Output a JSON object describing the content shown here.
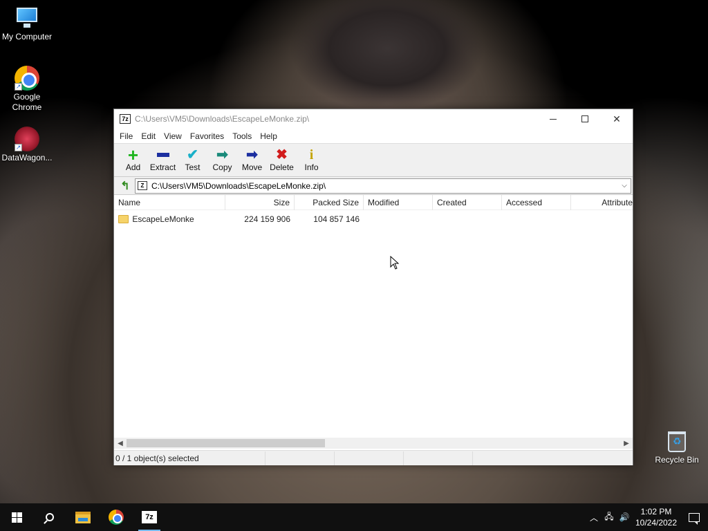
{
  "desktop": {
    "icons": [
      {
        "label_line1": "My Computer",
        "label_line2": ""
      },
      {
        "label_line1": "Google",
        "label_line2": "Chrome"
      },
      {
        "label_line1": "DataWagon...",
        "label_line2": ""
      }
    ],
    "recycle_bin": "Recycle Bin"
  },
  "window": {
    "title": "C:\\Users\\VM5\\Downloads\\EscapeLeMonke.zip\\",
    "app_badge": "7z",
    "menu": [
      "File",
      "Edit",
      "View",
      "Favorites",
      "Tools",
      "Help"
    ],
    "toolbar": [
      {
        "label": "Add",
        "icon": "plus-icon"
      },
      {
        "label": "Extract",
        "icon": "minus-icon"
      },
      {
        "label": "Test",
        "icon": "check-icon"
      },
      {
        "label": "Copy",
        "icon": "copy-arrow-icon"
      },
      {
        "label": "Move",
        "icon": "move-arrow-icon"
      },
      {
        "label": "Delete",
        "icon": "delete-x-icon"
      },
      {
        "label": "Info",
        "icon": "info-icon"
      }
    ],
    "address": "C:\\Users\\VM5\\Downloads\\EscapeLeMonke.zip\\",
    "columns": {
      "name": "Name",
      "size": "Size",
      "packed": "Packed Size",
      "modified": "Modified",
      "created": "Created",
      "accessed": "Accessed",
      "attributes": "Attribute"
    },
    "rows": [
      {
        "name": "EscapeLeMonke",
        "size": "224 159 906",
        "packed": "104 857 146",
        "modified": "",
        "created": "",
        "accessed": "",
        "attributes": ""
      }
    ],
    "status": {
      "selection": "0 / 1 object(s) selected",
      "cell2": "",
      "cell3": "",
      "cell4": ""
    }
  },
  "taskbar": {
    "time": "1:02 PM",
    "date": "10/24/2022",
    "pinned": [
      "start-icon",
      "search-icon",
      "file-explorer-icon",
      "chrome-icon",
      "7zip-icon"
    ]
  },
  "colors": {
    "taskbar_bg": "#101010",
    "active_indicator": "#76b9ed",
    "toolbar_bg": "#f0f0f0"
  }
}
